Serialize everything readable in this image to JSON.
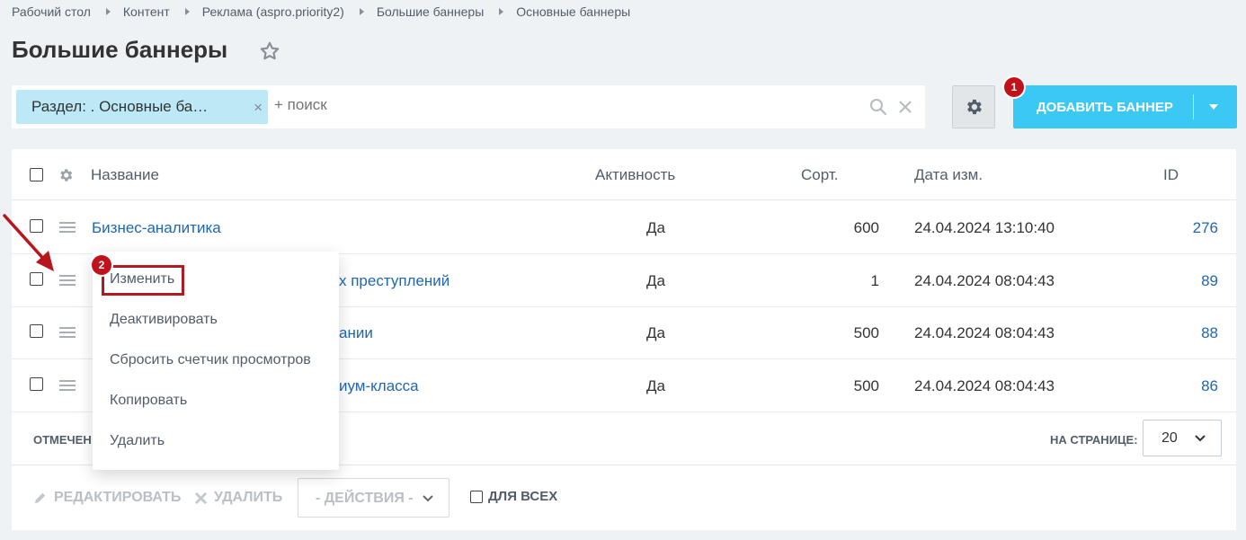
{
  "breadcrumb": [
    "Рабочий стол",
    "Контент",
    "Реклама (aspro.priority2)",
    "Большие баннеры",
    "Основные баннеры"
  ],
  "page_title": "Большие баннеры",
  "filter": {
    "tag_label": "Раздел: . Основные ба…",
    "tag_close": "×",
    "search_placeholder": "+ поиск"
  },
  "toolbar": {
    "add_button_label": "ДОБАВИТЬ БАННЕР"
  },
  "badges": {
    "first": "1",
    "second": "2"
  },
  "table": {
    "columns": [
      "Название",
      "Активность",
      "Сорт.",
      "Дата изм.",
      "ID"
    ],
    "rows": [
      {
        "name": "Бизнес-аналитика",
        "active": "Да",
        "sort": "600",
        "date": "24.04.2024 13:10:40",
        "id": "276"
      },
      {
        "name": "х преступлений",
        "active": "Да",
        "sort": "1",
        "date": "24.04.2024 08:04:43",
        "id": "89"
      },
      {
        "name": "ании",
        "active": "Да",
        "sort": "500",
        "date": "24.04.2024 08:04:43",
        "id": "88"
      },
      {
        "name": "иум-класса",
        "active": "Да",
        "sort": "500",
        "date": "24.04.2024 08:04:43",
        "id": "86"
      }
    ]
  },
  "footer": {
    "marked_label": "ОТМЕЧЕН",
    "per_page_label": "НА СТРАНИЦЕ:",
    "per_page_value": "20"
  },
  "actions": {
    "edit_label": "РЕДАКТИРОВАТЬ",
    "delete_label": "УДАЛИТЬ",
    "actions_placeholder": "- ДЕЙСТВИЯ -",
    "for_all_label": "ДЛЯ ВСЕХ"
  },
  "context_menu": {
    "items": [
      "Изменить",
      "Деактивировать",
      "Сбросить счетчик просмотров",
      "Копировать",
      "Удалить"
    ]
  },
  "colors": {
    "accent": "#3bc8f5",
    "link": "#2067b0",
    "badge": "#c1121c",
    "filter_tag": "#bde8f6"
  }
}
